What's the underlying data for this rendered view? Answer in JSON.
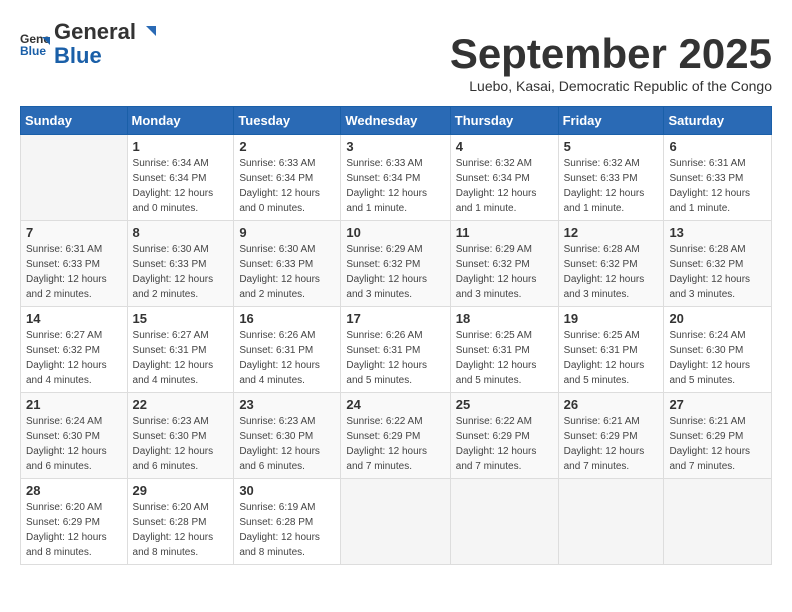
{
  "header": {
    "logo_line1": "General",
    "logo_line2": "Blue",
    "month_title": "September 2025",
    "subtitle": "Luebo, Kasai, Democratic Republic of the Congo"
  },
  "weekdays": [
    "Sunday",
    "Monday",
    "Tuesday",
    "Wednesday",
    "Thursday",
    "Friday",
    "Saturday"
  ],
  "weeks": [
    [
      {
        "day": "",
        "info": ""
      },
      {
        "day": "1",
        "info": "Sunrise: 6:34 AM\nSunset: 6:34 PM\nDaylight: 12 hours\nand 0 minutes."
      },
      {
        "day": "2",
        "info": "Sunrise: 6:33 AM\nSunset: 6:34 PM\nDaylight: 12 hours\nand 0 minutes."
      },
      {
        "day": "3",
        "info": "Sunrise: 6:33 AM\nSunset: 6:34 PM\nDaylight: 12 hours\nand 1 minute."
      },
      {
        "day": "4",
        "info": "Sunrise: 6:32 AM\nSunset: 6:34 PM\nDaylight: 12 hours\nand 1 minute."
      },
      {
        "day": "5",
        "info": "Sunrise: 6:32 AM\nSunset: 6:33 PM\nDaylight: 12 hours\nand 1 minute."
      },
      {
        "day": "6",
        "info": "Sunrise: 6:31 AM\nSunset: 6:33 PM\nDaylight: 12 hours\nand 1 minute."
      }
    ],
    [
      {
        "day": "7",
        "info": "Sunrise: 6:31 AM\nSunset: 6:33 PM\nDaylight: 12 hours\nand 2 minutes."
      },
      {
        "day": "8",
        "info": "Sunrise: 6:30 AM\nSunset: 6:33 PM\nDaylight: 12 hours\nand 2 minutes."
      },
      {
        "day": "9",
        "info": "Sunrise: 6:30 AM\nSunset: 6:33 PM\nDaylight: 12 hours\nand 2 minutes."
      },
      {
        "day": "10",
        "info": "Sunrise: 6:29 AM\nSunset: 6:32 PM\nDaylight: 12 hours\nand 3 minutes."
      },
      {
        "day": "11",
        "info": "Sunrise: 6:29 AM\nSunset: 6:32 PM\nDaylight: 12 hours\nand 3 minutes."
      },
      {
        "day": "12",
        "info": "Sunrise: 6:28 AM\nSunset: 6:32 PM\nDaylight: 12 hours\nand 3 minutes."
      },
      {
        "day": "13",
        "info": "Sunrise: 6:28 AM\nSunset: 6:32 PM\nDaylight: 12 hours\nand 3 minutes."
      }
    ],
    [
      {
        "day": "14",
        "info": "Sunrise: 6:27 AM\nSunset: 6:32 PM\nDaylight: 12 hours\nand 4 minutes."
      },
      {
        "day": "15",
        "info": "Sunrise: 6:27 AM\nSunset: 6:31 PM\nDaylight: 12 hours\nand 4 minutes."
      },
      {
        "day": "16",
        "info": "Sunrise: 6:26 AM\nSunset: 6:31 PM\nDaylight: 12 hours\nand 4 minutes."
      },
      {
        "day": "17",
        "info": "Sunrise: 6:26 AM\nSunset: 6:31 PM\nDaylight: 12 hours\nand 5 minutes."
      },
      {
        "day": "18",
        "info": "Sunrise: 6:25 AM\nSunset: 6:31 PM\nDaylight: 12 hours\nand 5 minutes."
      },
      {
        "day": "19",
        "info": "Sunrise: 6:25 AM\nSunset: 6:31 PM\nDaylight: 12 hours\nand 5 minutes."
      },
      {
        "day": "20",
        "info": "Sunrise: 6:24 AM\nSunset: 6:30 PM\nDaylight: 12 hours\nand 5 minutes."
      }
    ],
    [
      {
        "day": "21",
        "info": "Sunrise: 6:24 AM\nSunset: 6:30 PM\nDaylight: 12 hours\nand 6 minutes."
      },
      {
        "day": "22",
        "info": "Sunrise: 6:23 AM\nSunset: 6:30 PM\nDaylight: 12 hours\nand 6 minutes."
      },
      {
        "day": "23",
        "info": "Sunrise: 6:23 AM\nSunset: 6:30 PM\nDaylight: 12 hours\nand 6 minutes."
      },
      {
        "day": "24",
        "info": "Sunrise: 6:22 AM\nSunset: 6:29 PM\nDaylight: 12 hours\nand 7 minutes."
      },
      {
        "day": "25",
        "info": "Sunrise: 6:22 AM\nSunset: 6:29 PM\nDaylight: 12 hours\nand 7 minutes."
      },
      {
        "day": "26",
        "info": "Sunrise: 6:21 AM\nSunset: 6:29 PM\nDaylight: 12 hours\nand 7 minutes."
      },
      {
        "day": "27",
        "info": "Sunrise: 6:21 AM\nSunset: 6:29 PM\nDaylight: 12 hours\nand 7 minutes."
      }
    ],
    [
      {
        "day": "28",
        "info": "Sunrise: 6:20 AM\nSunset: 6:29 PM\nDaylight: 12 hours\nand 8 minutes."
      },
      {
        "day": "29",
        "info": "Sunrise: 6:20 AM\nSunset: 6:28 PM\nDaylight: 12 hours\nand 8 minutes."
      },
      {
        "day": "30",
        "info": "Sunrise: 6:19 AM\nSunset: 6:28 PM\nDaylight: 12 hours\nand 8 minutes."
      },
      {
        "day": "",
        "info": ""
      },
      {
        "day": "",
        "info": ""
      },
      {
        "day": "",
        "info": ""
      },
      {
        "day": "",
        "info": ""
      }
    ]
  ]
}
